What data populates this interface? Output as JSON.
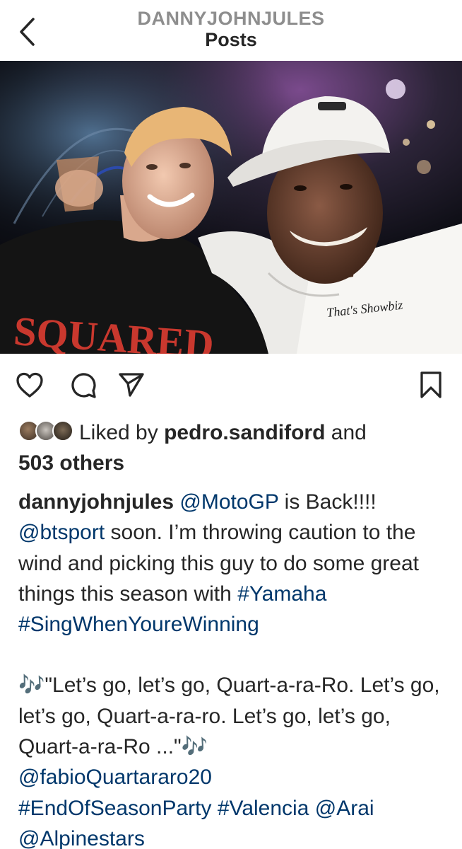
{
  "header": {
    "username": "DANNYJOHNJULES",
    "subtitle": "Posts"
  },
  "photo": {
    "shirt_text": "SQUARED",
    "badge_text": "That's Showbiz"
  },
  "likes": {
    "prefix": "Liked by",
    "user": "pedro.sandiford",
    "connector": "and",
    "others": "503 others"
  },
  "caption": {
    "username": "dannyjohnjules",
    "mention_motogp": "@MotoGP",
    "text_back": "is Back!!!!",
    "mention_btsport": "@btsport",
    "text_body": "soon. I’m throwing caution to the wind and picking this guy to do some great things this season with",
    "tag_yamaha": "#Yamaha",
    "tag_sing": "#SingWhenYoureWinning",
    "text_song": "🎶\"Let’s go, let’s go, Quart-a-ra-Ro. Let’s go, let’s go, Quart-a-ra-ro. Let’s go, let’s go, Quart-a-ra-Ro ...\"🎶",
    "mention_fabio": "@fabioQuartararo20",
    "tag_end": "#EndOfSeasonParty",
    "tag_valencia": "#Valencia",
    "mention_arai": "@Arai",
    "mention_alpinestars": "@Alpinestars"
  },
  "colors": {
    "link": "#00376b",
    "header_user": "#8e8e8e",
    "text": "#262626"
  },
  "icons": [
    "back-chevron-icon",
    "heart-icon",
    "comment-icon",
    "share-icon",
    "bookmark-icon"
  ]
}
